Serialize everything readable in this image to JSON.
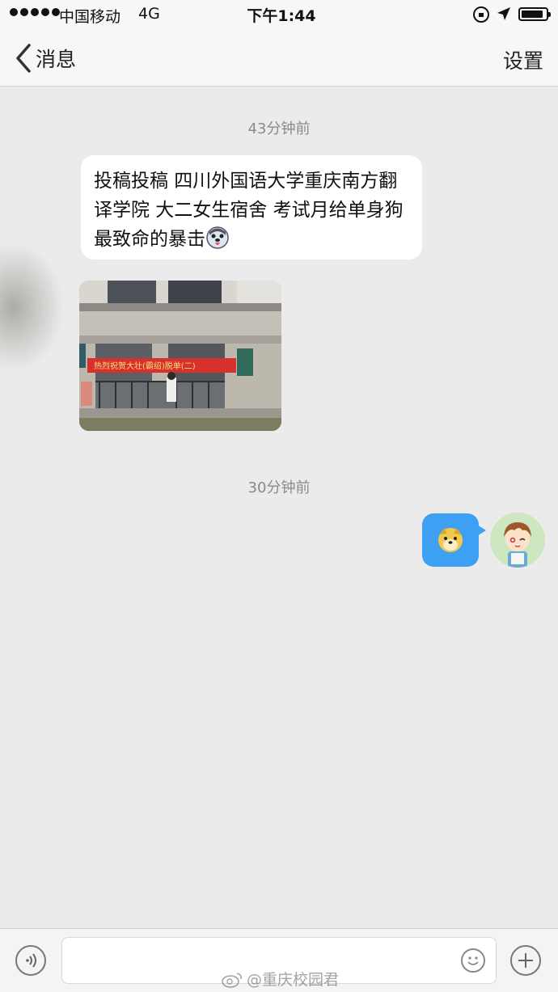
{
  "status_bar": {
    "carrier": "中国移动",
    "network": "4G",
    "time": "下午1:44"
  },
  "nav": {
    "back_label": "消息",
    "settings_label": "设置"
  },
  "messages": [
    {
      "timestamp": "43分钟前"
    },
    {
      "text": "投稿投稿 四川外国语大学重庆南方翻译学院 大二女生宿舍 考试月给单身狗最致命的暴击"
    },
    {
      "photo_banner_text": "热烈祝贺大壮(霸绍)脱单(二)"
    },
    {
      "timestamp": "30分钟前"
    }
  ],
  "input": {
    "placeholder": ""
  },
  "watermark": "@重庆校园君",
  "colors": {
    "sent_bubble": "#3ea0f3",
    "background": "#ebebeb"
  }
}
